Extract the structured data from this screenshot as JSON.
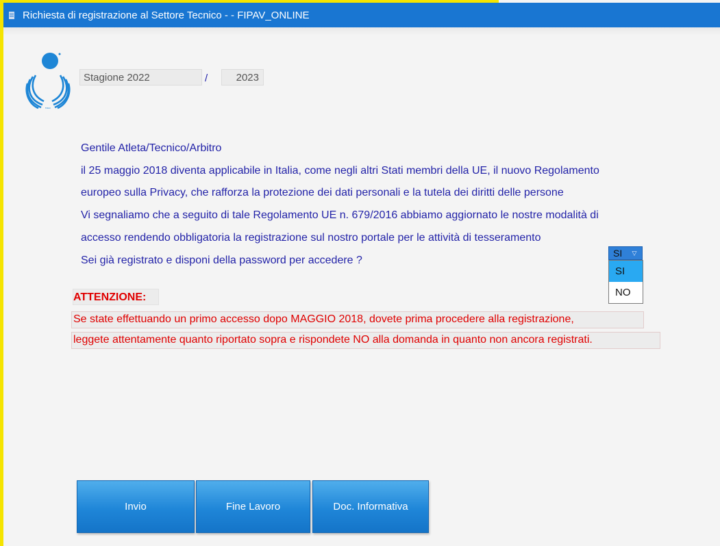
{
  "window": {
    "title": "Richiesta di registrazione al Settore Tecnico - - FIPAV_ONLINE",
    "icon": "document-icon"
  },
  "season": {
    "start_value": "Stagione 2022",
    "separator": "/",
    "end_value": "2023"
  },
  "info": {
    "lines": [
      "Gentile Atleta/Tecnico/Arbitro",
      "il 25 maggio 2018 diventa applicabile in Italia, come negli altri Stati membri della UE, il nuovo Regolamento",
      "europeo sulla Privacy, che rafforza la protezione dei dati personali e la tutela dei diritti delle persone",
      "Vi segnaliamo che a seguito di tale Regolamento UE n. 679/2016 abbiamo aggiornato le nostre modalità di",
      "accesso rendendo obbligatoria la registrazione sul nostro portale per le attività di tesseramento",
      "Sei già registrato e disponi della password per accedere ?"
    ]
  },
  "registered_select": {
    "value": "SI",
    "options": [
      "SI",
      "NO"
    ],
    "highlighted": "SI"
  },
  "attention": {
    "title": "ATTENZIONE:",
    "line1": "Se state effettuando un primo accesso dopo MAGGIO 2018, dovete prima procedere alla registrazione,",
    "line2": "leggete attentamente quanto riportato sopra e rispondete NO alla domanda in quanto non ancora registrati."
  },
  "buttons": {
    "invio": "Invio",
    "fine_lavoro": "Fine Lavoro",
    "doc_informativa": "Doc. Informativa"
  },
  "colors": {
    "title_bar": "#1976d2",
    "info_text": "#2323a8",
    "attention_text": "#e00000",
    "button": "#1f86d8",
    "highlight": "#29a9f2"
  }
}
